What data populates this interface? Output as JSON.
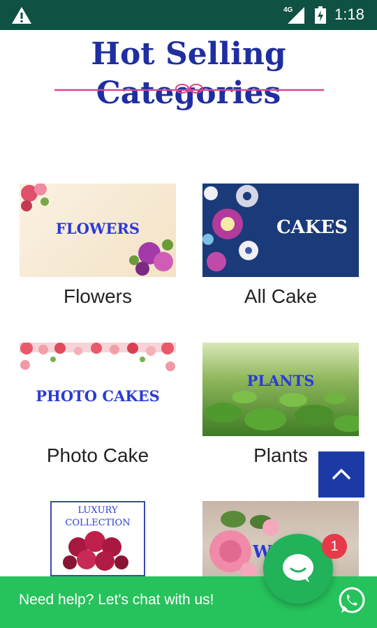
{
  "status_bar": {
    "network": "4G",
    "time": "1:18",
    "icons": [
      "warning-icon",
      "signal-icon",
      "battery-icon"
    ]
  },
  "title": {
    "line1": "Hot Selling",
    "line2": "Categories"
  },
  "categories": [
    {
      "image_text": "FLOWERS",
      "label": "Flowers"
    },
    {
      "image_text": "CAKES",
      "label": "All Cake"
    },
    {
      "image_text": "PHOTO CAKES",
      "label": "Photo Cake"
    },
    {
      "image_text": "PLANTS",
      "label": "Plants"
    },
    {
      "image_text_1": "LUXURY",
      "image_text_2": "COLLECTION"
    },
    {
      "image_text": "W"
    }
  ],
  "chat": {
    "text": "Need help? Let's chat with us!",
    "badge": "1"
  },
  "colors": {
    "status_bar": "#0f5142",
    "title": "#1f2ea0",
    "chat_green": "#26c25c",
    "scroll_button": "#1c3aa6",
    "badge": "#e63a4a"
  }
}
